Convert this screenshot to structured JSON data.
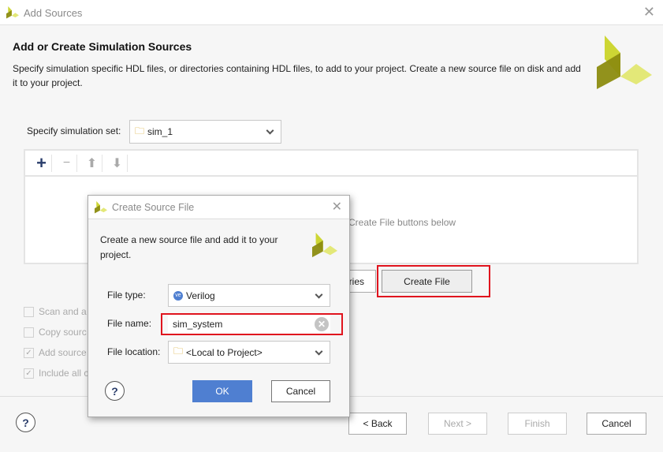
{
  "window": {
    "title": "Add Sources",
    "heading": "Add or Create Simulation Sources",
    "description": "Specify simulation specific HDL files, or directories containing HDL files, to add to your project. Create a new source file on disk and add it to your project."
  },
  "simset": {
    "label": "Specify simulation set:",
    "value": "sim_1"
  },
  "panel": {
    "hint": "Create File buttons below",
    "add_directories_partial": "ries",
    "create_file": "Create File"
  },
  "options": [
    {
      "label": "Scan and a",
      "checked": false
    },
    {
      "label": "Copy sourc",
      "checked": false
    },
    {
      "label": "Add source",
      "checked": true
    },
    {
      "label": "Include all c",
      "checked": true
    }
  ],
  "footer": {
    "back": "< Back",
    "next": "Next >",
    "finish": "Finish",
    "cancel": "Cancel",
    "help": "?"
  },
  "dialog": {
    "title": "Create Source File",
    "description": "Create a new source file and add it to your project.",
    "file_type_label": "File type:",
    "file_type": "Verilog",
    "file_name_label": "File name:",
    "file_name": "sim_system",
    "file_location_label": "File location:",
    "file_location": "<Local to Project>",
    "ok": "OK",
    "cancel": "Cancel",
    "help": "?"
  },
  "colors": {
    "accent": "#4f7fd1",
    "highlight": "#e0141e",
    "logo_light": "#e3e878",
    "logo_mid": "#cdd634",
    "logo_dark": "#8c8c10"
  }
}
